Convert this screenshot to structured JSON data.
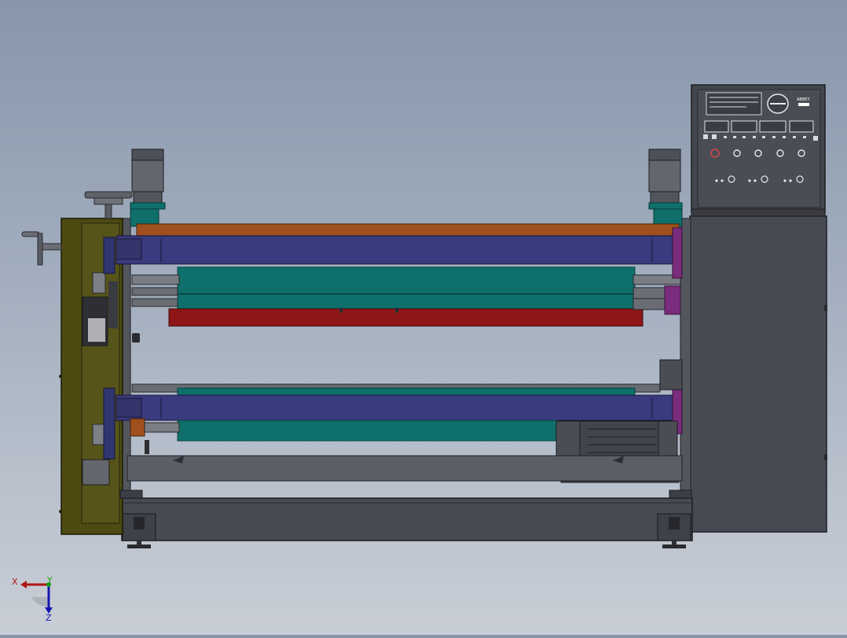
{
  "view": {
    "kind": "cad-model-viewport",
    "background_top": "#8796ab",
    "background_bottom": "#c9ced6"
  },
  "model": {
    "description_colors": {
      "side_plate": "#4d4a12",
      "frame": "#4a4c55",
      "roller_brown": "#a0501c",
      "roller_blue": "#3a3a7e",
      "roller_teal": "#0f6f6b",
      "roller_red": "#8e1618",
      "roller_gray": "#5c5e66",
      "cabinet": "#474a52",
      "control_panel": "#45474e",
      "motor_housing": "#55575e",
      "accent_magenta": "#7a2c7c"
    }
  },
  "control_panel": {
    "brand_text": "ABBEY"
  },
  "triad": {
    "x_label": "X",
    "y_label": "Y",
    "z_label": "Z",
    "x_color": "#b01515",
    "y_color": "#18a018",
    "z_color": "#1515b0"
  }
}
